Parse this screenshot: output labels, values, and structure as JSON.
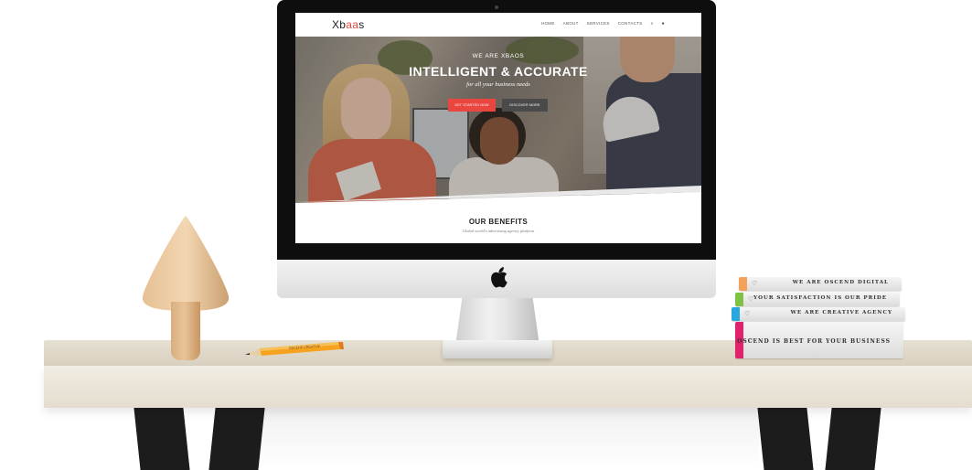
{
  "website": {
    "logo": {
      "prefix": "Xb",
      "highlight": "aa",
      "suffix": "s"
    },
    "nav": [
      "HOME",
      "ABOUT",
      "SERVICES",
      "CONTACTS"
    ],
    "hero": {
      "eyebrow": "WE ARE XBAOS",
      "headline": "INTELLIGENT & ACCURATE",
      "tagline": "for all your business needs",
      "primary_button": "GET STARTED NOW",
      "secondary_button": "DISCOVER MORE"
    },
    "benefits": {
      "title": "OUR BENEFITS",
      "subtitle": "Global world's advertising agency platform"
    }
  },
  "books": [
    {
      "label": "WE ARE OSCEND DIGITAL",
      "color": "#f4a259"
    },
    {
      "label": "YOUR SATISFACTION IS OUR PRIDE",
      "color": "#7dc242"
    },
    {
      "label": "WE ARE CREATIVE AGENCY",
      "color": "#29a8e0"
    },
    {
      "label": "OSCEND IS BEST FOR YOUR BUSINESS",
      "color": "#e2236b"
    }
  ],
  "pencil_text": "OSCEND CREATIVE",
  "colors": {
    "accent": "#e8463e",
    "desk": "#e6e0d2"
  }
}
